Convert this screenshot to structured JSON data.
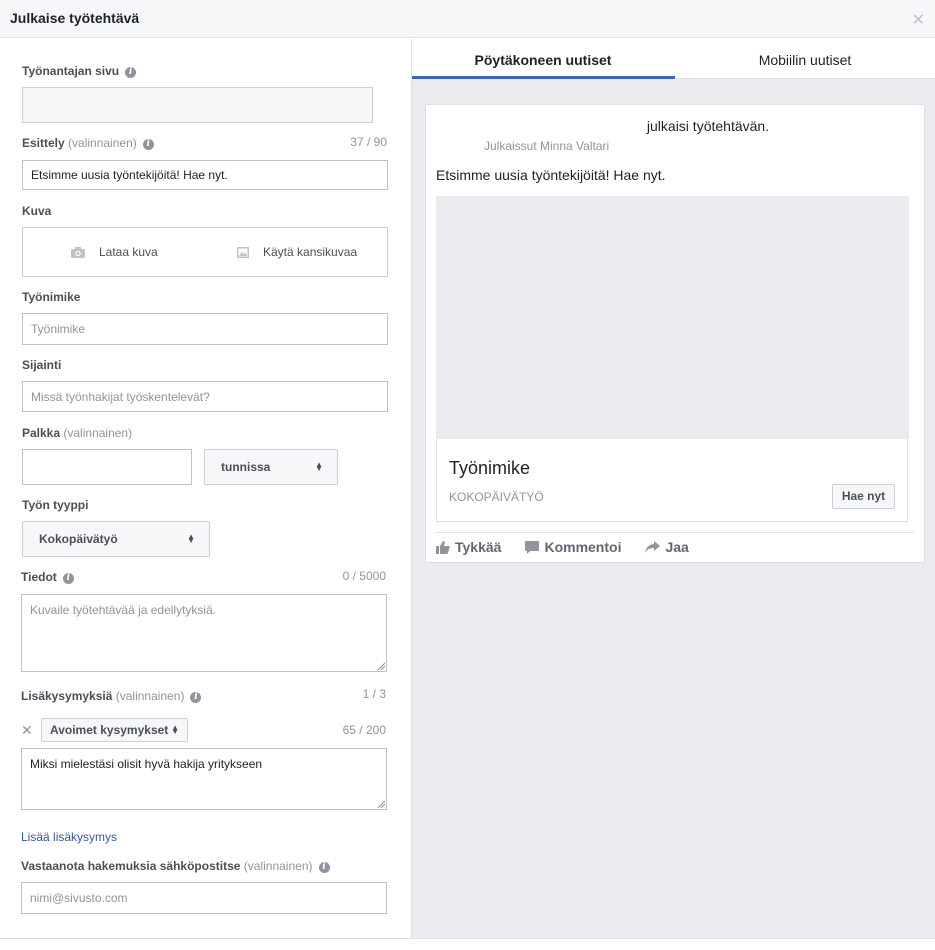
{
  "dialog": {
    "title": "Julkaise työtehtävä",
    "close_icon": "close-icon"
  },
  "form": {
    "page": {
      "label": "Työnantajan sivu",
      "value": ""
    },
    "intro": {
      "label": "Esittely",
      "optional": "(valinnainen)",
      "counter": "37 / 90",
      "value": "Etsimme uusia työntekijöitä! Hae nyt."
    },
    "photo": {
      "label": "Kuva",
      "upload": "Lataa kuva",
      "cover": "Käytä kansikuvaa"
    },
    "job_title": {
      "label": "Työnimike",
      "placeholder": "Työnimike"
    },
    "location": {
      "label": "Sijainti",
      "placeholder": "Missä työnhakijat työskentelevät?"
    },
    "salary": {
      "label": "Palkka",
      "optional": "(valinnainen)",
      "value": "",
      "period": "tunnissa"
    },
    "job_type": {
      "label": "Työn tyyppi",
      "value": "Kokopäivätyö"
    },
    "details": {
      "label": "Tiedot",
      "counter": "0 / 5000",
      "placeholder": "Kuvaile työtehtävää ja edellytyksiä."
    },
    "questions": {
      "label": "Lisäkysymyksiä",
      "optional": "(valinnainen)",
      "counter": "1 / 3",
      "type": "Avoimet kysymykset",
      "q_counter": "65 / 200",
      "question": "Miksi mielestäsi olisit hyvä hakija yritykseen",
      "add_link": "Lisää lisäkysymys"
    },
    "email": {
      "label": "Vastaanota hakemuksia sähköpostitse",
      "optional": "(valinnainen)",
      "placeholder": "nimi@sivusto.com"
    }
  },
  "preview": {
    "tabs": [
      {
        "label": "Pöytäkoneen uutiset",
        "active": true
      },
      {
        "label": "Mobiilin uutiset",
        "active": false
      }
    ],
    "action": "julkaisi työtehtävän.",
    "byline": "Julkaissut Minna Valtari",
    "message": "Etsimme uusia työntekijöitä! Hae nyt.",
    "job_title": "Työnimike",
    "job_type": "KOKOPÄIVÄTYÖ",
    "apply": "Hae nyt",
    "reactions": {
      "like": "Tykkää",
      "comment": "Kommentoi",
      "share": "Jaa"
    }
  },
  "colors": {
    "accent": "#4267b2",
    "link": "#365899",
    "preview_bg": "#e9ebee"
  }
}
